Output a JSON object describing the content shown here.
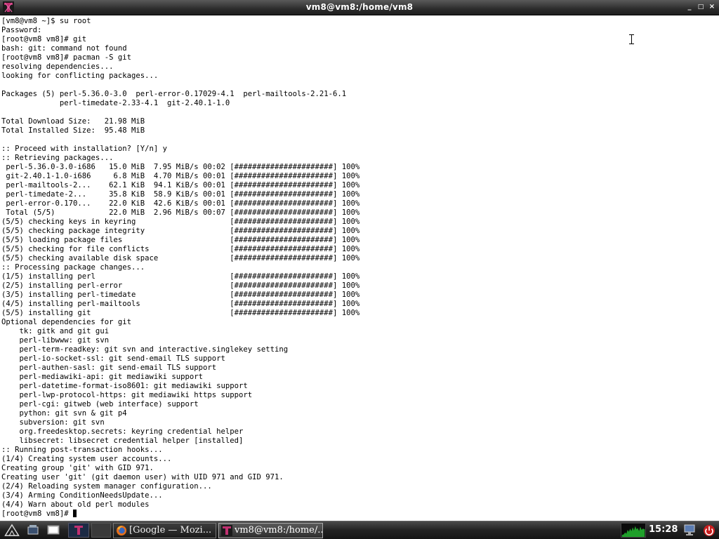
{
  "window": {
    "title": "vm8@vm8:/home/vm8"
  },
  "window_controls": [
    "_",
    "□",
    "×"
  ],
  "terminal": {
    "lines": [
      "[vm8@vm8 ~]$ su root",
      "Password:",
      "[root@vm8 vm8]# git",
      "bash: git: command not found",
      "[root@vm8 vm8]# pacman -S git",
      "resolving dependencies...",
      "looking for conflicting packages...",
      "",
      "Packages (5) perl-5.36.0-3.0  perl-error-0.17029-4.1  perl-mailtools-2.21-6.1",
      "             perl-timedate-2.33-4.1  git-2.40.1-1.0",
      "",
      "Total Download Size:   21.98 MiB",
      "Total Installed Size:  95.48 MiB",
      "",
      ":: Proceed with installation? [Y/n] y",
      ":: Retrieving packages...",
      " perl-5.36.0-3.0-i686   15.0 MiB  7.95 MiB/s 00:02 [######################] 100%",
      " git-2.40.1-1.0-i686     6.8 MiB  4.70 MiB/s 00:01 [######################] 100%",
      " perl-mailtools-2...    62.1 KiB  94.1 KiB/s 00:01 [######################] 100%",
      " perl-timedate-2...     35.8 KiB  58.9 KiB/s 00:01 [######################] 100%",
      " perl-error-0.170...    22.0 KiB  42.6 KiB/s 00:01 [######################] 100%",
      " Total (5/5)            22.0 MiB  2.96 MiB/s 00:07 [######################] 100%",
      "(5/5) checking keys in keyring                     [######################] 100%",
      "(5/5) checking package integrity                   [######################] 100%",
      "(5/5) loading package files                        [######################] 100%",
      "(5/5) checking for file conflicts                  [######################] 100%",
      "(5/5) checking available disk space                [######################] 100%",
      ":: Processing package changes...",
      "(1/5) installing perl                              [######################] 100%",
      "(2/5) installing perl-error                        [######################] 100%",
      "(3/5) installing perl-timedate                     [######################] 100%",
      "(4/5) installing perl-mailtools                    [######################] 100%",
      "(5/5) installing git                               [######################] 100%",
      "Optional dependencies for git",
      "    tk: gitk and git gui",
      "    perl-libwww: git svn",
      "    perl-term-readkey: git svn and interactive.singlekey setting",
      "    perl-io-socket-ssl: git send-email TLS support",
      "    perl-authen-sasl: git send-email TLS support",
      "    perl-mediawiki-api: git mediawiki support",
      "    perl-datetime-format-iso8601: git mediawiki support",
      "    perl-lwp-protocol-https: git mediawiki https support",
      "    perl-cgi: gitweb (web interface) support",
      "    python: git svn & git p4",
      "    subversion: git svn",
      "    org.freedesktop.secrets: keyring credential helper",
      "    libsecret: libsecret credential helper [installed]",
      ":: Running post-transaction hooks...",
      "(1/4) Creating system user accounts...",
      "Creating group 'git' with GID 971.",
      "Creating user 'git' (git daemon user) with UID 971 and GID 971.",
      "(2/4) Reloading system manager configuration...",
      "(3/4) Arming ConditionNeedsUpdate...",
      "(4/4) Warn about old perl modules"
    ],
    "prompt": "[root@vm8 vm8]# "
  },
  "taskbar": {
    "tasks": [
      {
        "label": "[Google — Mozi...",
        "icon": "firefox-icon"
      },
      {
        "label": "vm8@vm8:/home/...",
        "icon": "terminal-icon",
        "active": true
      }
    ],
    "clock": "15:28"
  },
  "colors": {
    "terminal_bg": "#ffffff",
    "terminal_fg": "#000000",
    "titlebar": "#2c2c2c",
    "taskbar": "#222222",
    "terminal_icon": "#c03070"
  }
}
